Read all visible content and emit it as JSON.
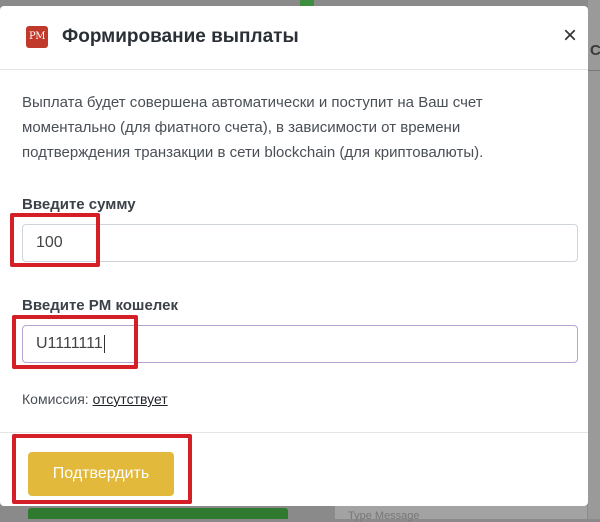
{
  "modal": {
    "logo_text": "PM",
    "title": "Формирование выплаты",
    "close_glyph": "×",
    "description": "Выплата будет совершена автоматически и поступит на Ваш счет моментально (для фиатного счета), в зависимости от времени подтверждения транзакции в сети blockchain (для криптовалюты)."
  },
  "form": {
    "amount_label": "Введите сумму",
    "amount_value": "100",
    "wallet_label": "Введите PM кошелек",
    "wallet_value": "U1111111",
    "commission_label": "Комиссия:",
    "commission_value": "отсутствует",
    "confirm_label": "Подтвердить"
  },
  "background": {
    "partial_letter": "С",
    "partial_input_text": "Type Message"
  },
  "colors": {
    "confirm_button": "#e2b93a",
    "highlight_box": "#d51f26",
    "logo": "#c0392b"
  },
  "icons": {
    "close": "close-icon",
    "logo": "pm-logo-icon"
  }
}
